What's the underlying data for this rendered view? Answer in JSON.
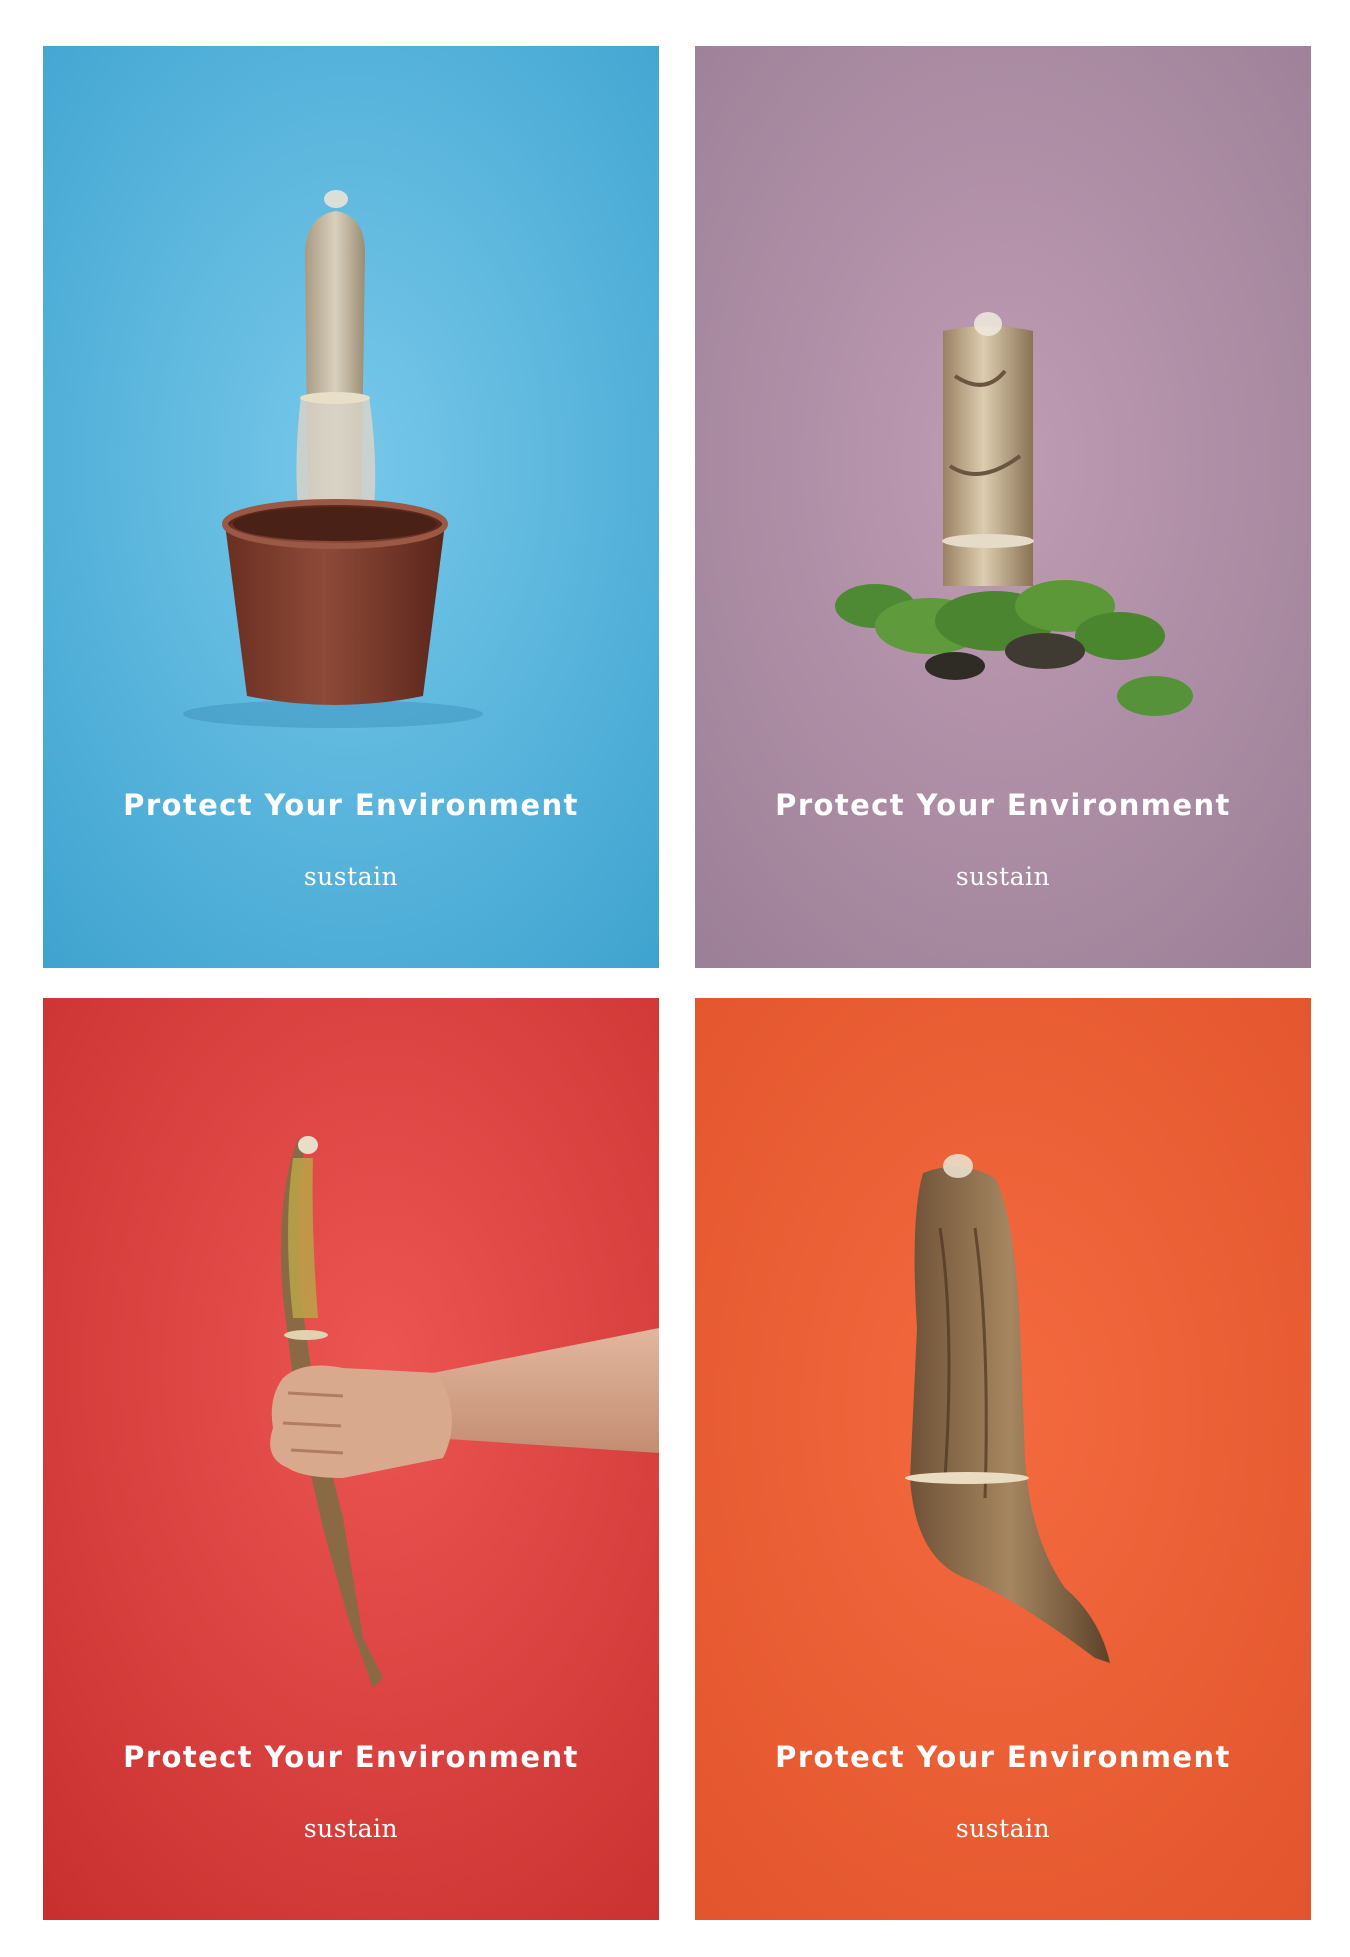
{
  "posters": [
    {
      "subject": "cactus in pot",
      "background_color": "#5bbbe0",
      "tagline": "Protect Your Environment",
      "brand": "sustain"
    },
    {
      "subject": "birch log on moss",
      "background_color": "#b48ea8",
      "tagline": "Protect Your Environment",
      "brand": "sustain"
    },
    {
      "subject": "hand holding mossy branch",
      "background_color": "#e24a48",
      "tagline": "Protect Your Environment",
      "brand": "sustain"
    },
    {
      "subject": "curved driftwood",
      "background_color": "#ee5e35",
      "tagline": "Protect Your Environment",
      "brand": "sustain"
    }
  ]
}
